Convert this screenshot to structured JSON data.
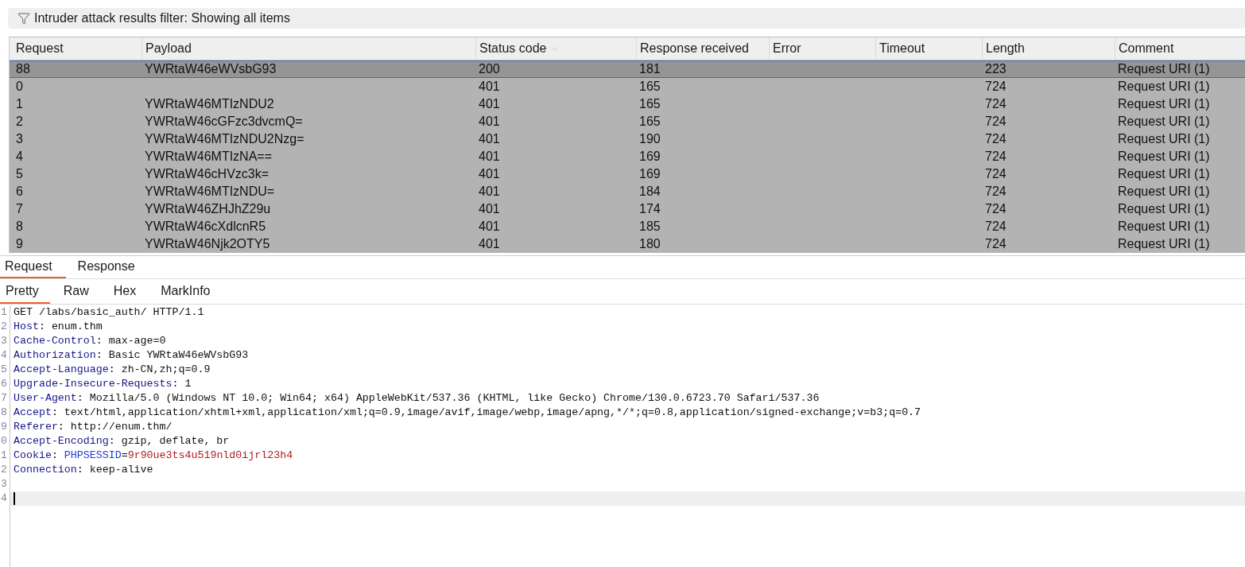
{
  "filter_bar": {
    "text": "Intruder attack results filter: Showing all items"
  },
  "table": {
    "columns": [
      {
        "label": "Request",
        "sorted": false
      },
      {
        "label": "Payload",
        "sorted": false
      },
      {
        "label": "Status code",
        "sorted": true
      },
      {
        "label": "Response received",
        "sorted": false
      },
      {
        "label": "Error",
        "sorted": false
      },
      {
        "label": "Timeout",
        "sorted": false
      },
      {
        "label": "Length",
        "sorted": false
      },
      {
        "label": "Comment",
        "sorted": false
      }
    ],
    "rows": [
      {
        "selected": true,
        "request": "88",
        "payload": "YWRtaW46eWVsbG93",
        "status_code": "200",
        "response_received": "181",
        "length": "223",
        "comment": "Request URI (1)"
      },
      {
        "selected": false,
        "request": "0",
        "status_code": "401",
        "response_received": "165",
        "length": "724",
        "comment": "Request URI (1)"
      },
      {
        "selected": false,
        "request": "1",
        "payload": "YWRtaW46MTIzNDU2",
        "status_code": "401",
        "response_received": "165",
        "length": "724",
        "comment": "Request URI (1)"
      },
      {
        "selected": false,
        "request": "2",
        "payload": "YWRtaW46cGFzc3dvcmQ=",
        "status_code": "401",
        "response_received": "165",
        "length": "724",
        "comment": "Request URI (1)"
      },
      {
        "selected": false,
        "request": "3",
        "payload": "YWRtaW46MTIzNDU2Nzg=",
        "status_code": "401",
        "response_received": "190",
        "length": "724",
        "comment": "Request URI (1)"
      },
      {
        "selected": false,
        "request": "4",
        "payload": "YWRtaW46MTIzNA==",
        "status_code": "401",
        "response_received": "169",
        "length": "724",
        "comment": "Request URI (1)"
      },
      {
        "selected": false,
        "request": "5",
        "payload": "YWRtaW46cHVzc3k=",
        "status_code": "401",
        "response_received": "169",
        "length": "724",
        "comment": "Request URI (1)"
      },
      {
        "selected": false,
        "request": "6",
        "payload": "YWRtaW46MTIzNDU=",
        "status_code": "401",
        "response_received": "184",
        "length": "724",
        "comment": "Request URI (1)"
      },
      {
        "selected": false,
        "request": "7",
        "payload": "YWRtaW46ZHJhZ29u",
        "status_code": "401",
        "response_received": "174",
        "length": "724",
        "comment": "Request URI (1)"
      },
      {
        "selected": false,
        "request": "8",
        "payload": "YWRtaW46cXdlcnR5",
        "status_code": "401",
        "response_received": "185",
        "length": "724",
        "comment": "Request URI (1)"
      },
      {
        "selected": false,
        "request": "9",
        "payload": "YWRtaW46Njk2OTY5",
        "status_code": "401",
        "response_received": "180",
        "length": "724",
        "comment": "Request URI (1)"
      }
    ]
  },
  "message_tabs": [
    {
      "label": "Request",
      "selected": true
    },
    {
      "label": "Response",
      "selected": false
    }
  ],
  "view_tabs": [
    {
      "label": "Pretty",
      "selected": true
    },
    {
      "label": "Raw",
      "selected": false
    },
    {
      "label": "Hex",
      "selected": false
    },
    {
      "label": "MarkInfo",
      "selected": false
    }
  ],
  "editor": {
    "lines": [
      {
        "number": "1",
        "current": false,
        "parts": [
          {
            "kind": "plain",
            "text": "GET /labs/basic_auth/ HTTP/1.1"
          }
        ]
      },
      {
        "number": "2",
        "current": false,
        "parts": [
          {
            "kind": "name",
            "text": "Host"
          },
          {
            "kind": "plain",
            "text": ": enum.thm"
          }
        ]
      },
      {
        "number": "3",
        "current": false,
        "parts": [
          {
            "kind": "name",
            "text": "Cache-Control"
          },
          {
            "kind": "plain",
            "text": ": max-age=0"
          }
        ]
      },
      {
        "number": "4",
        "current": false,
        "parts": [
          {
            "kind": "name",
            "text": "Authorization"
          },
          {
            "kind": "plain",
            "text": ": Basic YWRtaW46eWVsbG93"
          }
        ]
      },
      {
        "number": "5",
        "current": false,
        "parts": [
          {
            "kind": "name",
            "text": "Accept-Language"
          },
          {
            "kind": "plain",
            "text": ": zh-CN,zh;q=0.9"
          }
        ]
      },
      {
        "number": "6",
        "current": false,
        "parts": [
          {
            "kind": "name",
            "text": "Upgrade-Insecure-Requests"
          },
          {
            "kind": "plain",
            "text": ": 1"
          }
        ]
      },
      {
        "number": "7",
        "current": false,
        "parts": [
          {
            "kind": "name",
            "text": "User-Agent"
          },
          {
            "kind": "plain",
            "text": ": Mozilla/5.0 (Windows NT 10.0; Win64; x64) AppleWebKit/537.36 (KHTML, like Gecko) Chrome/130.0.6723.70 Safari/537.36"
          }
        ]
      },
      {
        "number": "8",
        "current": false,
        "parts": [
          {
            "kind": "name",
            "text": "Accept"
          },
          {
            "kind": "plain",
            "text": ": text/html,application/xhtml+xml,application/xml;q=0.9,image/avif,image/webp,image/apng,*/*;q=0.8,application/signed-exchange;v=b3;q=0.7"
          }
        ]
      },
      {
        "number": "9",
        "current": false,
        "parts": [
          {
            "kind": "name",
            "text": "Referer"
          },
          {
            "kind": "plain",
            "text": ": http://enum.thm/"
          }
        ]
      },
      {
        "number": "0",
        "current": false,
        "parts": [
          {
            "kind": "name",
            "text": "Accept-Encoding"
          },
          {
            "kind": "plain",
            "text": ": gzip, deflate, br"
          }
        ]
      },
      {
        "number": "1",
        "current": false,
        "parts": [
          {
            "kind": "name",
            "text": "Cookie"
          },
          {
            "kind": "plain",
            "text": ": "
          },
          {
            "kind": "cookie_name",
            "text": "PHPSESSID"
          },
          {
            "kind": "plain",
            "text": "="
          },
          {
            "kind": "cookie_value",
            "text": "9r90ue3ts4u519nld0ijrl23h4"
          }
        ]
      },
      {
        "number": "2",
        "current": false,
        "parts": [
          {
            "kind": "name",
            "text": "Connection"
          },
          {
            "kind": "plain",
            "text": ": keep-alive"
          }
        ]
      },
      {
        "number": "3",
        "current": false
      },
      {
        "number": "4",
        "current": true
      }
    ]
  }
}
